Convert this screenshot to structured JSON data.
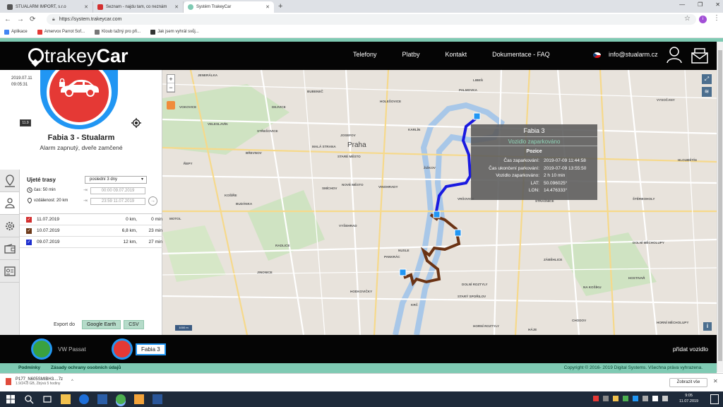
{
  "browser": {
    "tabs": [
      {
        "title": "STUALARM IMPORT, s.r.o",
        "active": false
      },
      {
        "title": "Seznam - najdu tam, co neznám",
        "active": false
      },
      {
        "title": "Systém TrakeyCar",
        "active": true
      }
    ],
    "url": "https://system.trakeycar.com",
    "bookmarks": [
      "Aplikace",
      "Amervox Parrot Sof...",
      "Kloub tažný pro při...",
      "Jak jsem vyhrál svůj..."
    ],
    "profile_initial": "i"
  },
  "header": {
    "logo_light": "trakey",
    "logo_bold": "Car",
    "nav": [
      "Telefony",
      "Platby",
      "Kontakt",
      "Dokumentace - FAQ"
    ],
    "email": "info@stualarm.cz"
  },
  "car": {
    "date": "2019.07.11",
    "time": "09:05:31",
    "battery": "11.9",
    "name": "Fabia 3 - Stualarm",
    "status": "Alarm zapnutý, dveře zamčené"
  },
  "routes": {
    "title": "Ujeté trasy",
    "range": "poslední 3 dny",
    "time_label": "čas: 50 min",
    "dist_label": "vzdálenost: 20 km",
    "from": "00:00 09.07.2019",
    "to": "23:59 11.07.2019",
    "items": [
      {
        "date": "11.07.2019",
        "km": "0 km,",
        "min": "0 min",
        "color": "#d32f2f"
      },
      {
        "date": "10.07.2019",
        "km": "6,8 km,",
        "min": "23 min",
        "color": "#6d3a1a"
      },
      {
        "date": "09.07.2019",
        "km": "12 km,",
        "min": "27 min",
        "color": "#1e2fcf"
      }
    ],
    "export_label": "Export do",
    "export_google": "Google Earth",
    "export_csv": "CSV"
  },
  "map": {
    "city": "Praha",
    "labels": [
      {
        "t": "JENERÁLKA"
      },
      {
        "t": "BUBENEČ"
      },
      {
        "t": "HOLEŠOVICE"
      },
      {
        "t": "LIBEŇ"
      },
      {
        "t": "PALMOVKA"
      },
      {
        "t": "VOKOVICE"
      },
      {
        "t": "DEJVICE"
      },
      {
        "t": "ŘEPY"
      },
      {
        "t": "STŘEŠOVICE"
      },
      {
        "t": "KARLÍN"
      },
      {
        "t": "VELESLAVÍN"
      },
      {
        "t": "JOSEFOV"
      },
      {
        "t": "MALÁ STRANA"
      },
      {
        "t": "STARÉ MĚSTO"
      },
      {
        "t": "ŽIŽKOV"
      },
      {
        "t": "BŘEVNOV"
      },
      {
        "t": "NOVÉ MĚSTO"
      },
      {
        "t": "VINOHRADY"
      },
      {
        "t": "SMÍCHOV"
      },
      {
        "t": "STRAŠNICE"
      },
      {
        "t": "KOŠÍŘE"
      },
      {
        "t": "BUDÁNKA"
      },
      {
        "t": "VRŠOVICE"
      },
      {
        "t": "MOTOL"
      },
      {
        "t": "VYŠEHRAD"
      },
      {
        "t": "ŠTĚRBOHOLY"
      },
      {
        "t": "RADLICE"
      },
      {
        "t": "NUSLE"
      },
      {
        "t": "PANKRÁC"
      },
      {
        "t": "ZÁBĚHLICE"
      },
      {
        "t": "DOLNÍ MĚCHOLUPY"
      },
      {
        "t": "JINONICE"
      },
      {
        "t": "DOLNÍ ROZTYLY"
      },
      {
        "t": "HOSTIVAŘ"
      },
      {
        "t": "STARÝ SPOŘILOV"
      },
      {
        "t": "NA KOŠÍKU"
      },
      {
        "t": "HODKOVIČKY"
      },
      {
        "t": "KRČ"
      },
      {
        "t": "CHODOV"
      },
      {
        "t": "HORNÍ ROZTYLY"
      },
      {
        "t": "HORNÍ MĚCHOLUPY"
      },
      {
        "t": "HÁJE"
      },
      {
        "t": "VYSOČANY"
      },
      {
        "t": "HLOUBĚTÍN"
      }
    ],
    "scale": "1000 m"
  },
  "popup": {
    "title": "Fabia 3",
    "status": "Vozidlo zaparkováno",
    "subtitle": "Pozice",
    "rows": [
      {
        "label": "Čas zaparkování:",
        "value": "2019-07-09 11:44:58"
      },
      {
        "label": "Čas ukončení parkování:",
        "value": "2019-07-09 13:55:50"
      },
      {
        "label": "Vozidlo zaparkováno:",
        "value": "2 h 10 min"
      },
      {
        "label": "LAT:",
        "value": "50.096025°"
      },
      {
        "label": "LON:",
        "value": "14.476333°"
      }
    ]
  },
  "vehicles": {
    "v1": "VW Passat",
    "v2": "Fabia 3",
    "add": "přidat vozidlo"
  },
  "footer": {
    "terms": "Podmínky",
    "privacy": "Zásady ochrany osobních údajů",
    "copyright": "Copyright © 2016- 2019 Digital Systems. Všechna práva vyhrazena."
  },
  "downloads": {
    "file": "P177_N605SMIBH3....7z",
    "sub": "1.9/24.8 GB, Zbývá 5 hodiny",
    "show_all": "Zobrazit vše"
  },
  "taskbar": {
    "time": "9:05",
    "date": "11.07.2019"
  }
}
